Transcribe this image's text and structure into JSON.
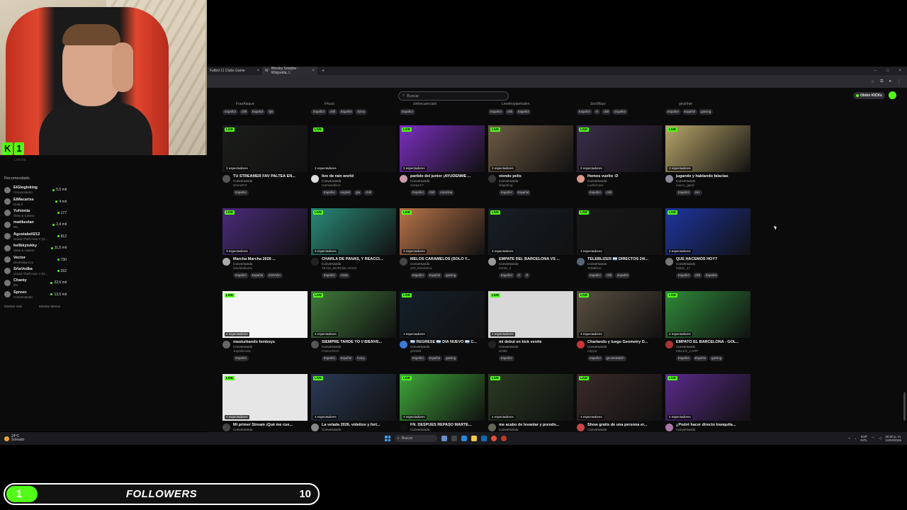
{
  "kick_badge": {
    "logo": "K",
    "count": "1"
  },
  "sidebar": {
    "topline": "Loncha",
    "title": "Recomendado",
    "items": [
      {
        "name": "ElGlogloking",
        "category": "Conversando",
        "count": "5,5 mil"
      },
      {
        "name": "ElMacariss",
        "category": "Dota 2",
        "count": "4 mil"
      },
      {
        "name": "Yuhinnta",
        "category": "Slots & Casino",
        "count": "177"
      },
      {
        "name": "mattkeelan",
        "category": "IRL",
        "count": "2,4 mil"
      },
      {
        "name": "Agustabell212",
        "category": "Grand Theft Auto V (G...",
        "count": "812"
      },
      {
        "name": "hellkkytokky",
        "category": "Slots & Casino",
        "count": "11,5 mil"
      },
      {
        "name": "Vector",
        "category": "Devil May Cry",
        "count": "730"
      },
      {
        "name": "SrtaVodka",
        "category": "Grand Theft Auto V (G...",
        "count": "262"
      },
      {
        "name": "Chanty",
        "category": "IRL",
        "count": "22,6 mil"
      },
      {
        "name": "Spreen",
        "category": "Conversando",
        "count": "13,5 mil"
      }
    ],
    "show_more": "Mostrar más",
    "show_less": "Mostrar Menos"
  },
  "browser": {
    "tabs": [
      {
        "title": "Futbol 11 Clubs Game"
      },
      {
        "title": "Wesley Sneijder - Wikipedia, L"
      }
    ],
    "search_placeholder": "Buscar",
    "get_kicks": "Obtén KICKs"
  },
  "top_row": [
    {
      "user": "FranAlaque",
      "tags": [
        "Español",
        "chill",
        "Español",
        "fps"
      ]
    },
    {
      "user": "F4uco",
      "tags": [
        "Español",
        "chill",
        "Español",
        "funny"
      ]
    },
    {
      "user": "sinfrecuenciatv",
      "tags": [
        "Español"
      ]
    },
    {
      "user": "Leontroplaelvalen",
      "tags": [
        "Español",
        "chill",
        "Español"
      ]
    },
    {
      "user": "SixxWayz",
      "tags": [
        "Español",
        "irl",
        "chill",
        "Español"
      ]
    },
    {
      "user": "ginshher",
      "tags": [
        "Español",
        "Español",
        "gaming"
      ]
    }
  ],
  "streams": [
    {
      "viewers": "3 espectadores",
      "title": "TU STREAMER FAV PALTEA EN...",
      "category": "Conversando",
      "user": "DracoPrrr",
      "tags": [
        "Español"
      ],
      "thumb": "#1b1d1a",
      "avatar": "#555"
    },
    {
      "viewers": "3 espectadores",
      "title": "live de rain world",
      "category": "Conversando",
      "user": "Gamaedirect",
      "tags": [
        "Español",
        "english",
        "gta",
        "chill"
      ],
      "thumb": "#0d0d0f",
      "avatar": "#ddd"
    },
    {
      "viewers": "3 espectadores",
      "title": "partido del junior ¡AYUDENME ...",
      "category": "Conversando",
      "user": "Gedye17",
      "tags": [
        "Español",
        "chill",
        "colombia"
      ],
      "thumb": "#7b2fbf",
      "avatar": "#c9a"
    },
    {
      "viewers": "3 espectadores",
      "title": "viendo pelis",
      "category": "Conversando",
      "user": "lafigoking",
      "tags": [
        "Español",
        "Español"
      ],
      "thumb": "#6e5a44",
      "avatar": "#333"
    },
    {
      "viewers": "3 espectadores",
      "title": "Hemos vuelto :D",
      "category": "Conversando",
      "user": "LudmiCaro",
      "tags": [
        "Español",
        "chill"
      ],
      "thumb": "#3a2e4a",
      "avatar": "#d98"
    },
    {
      "viewers": "3 espectadores",
      "title": "jugando y hablando falacias",
      "category": "Conversando",
      "user": "marce_gardi",
      "tags": [
        "Español",
        "18+"
      ],
      "thumb": "#b8a56a",
      "avatar": "#889"
    },
    {
      "viewers": "3 espectadores",
      "title": "Marcha Marcha 2026 ...",
      "category": "Conversando",
      "user": "latvdelabuelo",
      "tags": [
        "Español",
        "Español",
        "ESPAÑA"
      ],
      "thumb": "#4a2c7a",
      "avatar": "#aaa"
    },
    {
      "viewers": "3 espectadores",
      "title": "CHARLA DE PANAS, Y REACCI...",
      "category": "Conversando",
      "user": "TEAM_MURCIELAGOS",
      "tags": [
        "Español",
        "chats"
      ],
      "thumb": "#2a8a78",
      "avatar": "#222"
    },
    {
      "viewers": "3 espectadores",
      "title": "MELOS CARAMELOS (SOLO Y...",
      "category": "Conversando",
      "user": "s20_assassino",
      "tags": [
        "Español",
        "Español",
        "gaming"
      ],
      "thumb": "#b8744a",
      "avatar": "#444"
    },
    {
      "viewers": "3 espectadores",
      "title": "EMPATE DEL BARCELONA VS ...",
      "category": "Conversando",
      "user": "totoss_2",
      "tags": [
        "Español",
        "irl",
        "irl"
      ],
      "thumb": "#161e26",
      "avatar": "#999"
    },
    {
      "viewers": "3 espectadores",
      "title": "TELEBLIZER 🇦🇷 DIRECTOS 24/...",
      "category": "Conversando",
      "user": "TeleBlizer",
      "tags": [
        "Español",
        "chill",
        "Español"
      ],
      "thumb": "#181818",
      "avatar": "#567"
    },
    {
      "viewers": "3 espectadores",
      "title": "QUE HACEMOS HOY?",
      "category": "Conversando",
      "user": "Mdiaz_17",
      "tags": [
        "Español",
        "chill",
        "Español"
      ],
      "thumb": "#1e35a0",
      "avatar": "#777"
    },
    {
      "viewers": "4 espectadores",
      "title": "masturbando femboys",
      "category": "Conversando",
      "user": "Jugodeuvas",
      "tags": [
        "Español"
      ],
      "thumb": "#f5f5f5",
      "avatar": "#666"
    },
    {
      "viewers": "4 espectadores",
      "title": "SIEMPRE TARDE YO // BIENVE...",
      "category": "Conversando",
      "user": "FrancoTe12",
      "tags": [
        "Español",
        "Español",
        "funny"
      ],
      "thumb": "#3f7a3a",
      "avatar": "#555"
    },
    {
      "viewers": "4 espectadores",
      "title": "🇦🇷 REGRESE 🇦🇷 DIA NUEVO 🇦🇷 C...",
      "category": "Conversando",
      "user": "gex569",
      "tags": [
        "Español",
        "Español",
        "gaming"
      ],
      "thumb": "#14202a",
      "avatar": "#3a7bd5"
    },
    {
      "viewers": "4 espectadores",
      "title": "mi debut en kick venite",
      "category": "Conversando",
      "user": "W3ktt",
      "tags": [
        "Español"
      ],
      "thumb": "#d8d8d8",
      "avatar": "#222"
    },
    {
      "viewers": "4 espectadores",
      "title": "Charlando y luego Geometry D...",
      "category": "Conversando",
      "user": "relpyxt",
      "tags": [
        "Español",
        "geometrdash"
      ],
      "thumb": "#5a5040",
      "avatar": "#c33"
    },
    {
      "viewers": "4 espectadores",
      "title": "EMPATO EL BARCELONA - GOL...",
      "category": "Conversando",
      "user": "MELKO_CARP",
      "tags": [
        "Español",
        "Español",
        "gaming"
      ],
      "thumb": "#2f8a3a",
      "avatar": "#a33"
    },
    {
      "viewers": "4 espectadores",
      "title": "Mi primer Stream ¡Qué me cue...",
      "category": "Conversando",
      "user": "",
      "tags": [],
      "thumb": "#e6e6e6",
      "avatar": "#444"
    },
    {
      "viewers": "4 espectadores",
      "title": "La velada 2026, videitos y fort...",
      "category": "Conversando",
      "user": "",
      "tags": [],
      "thumb": "#2a3a55",
      "avatar": "#888"
    },
    {
      "viewers": "4 espectadores",
      "title": "FN. DESPUES REPASO MARTE...",
      "category": "Conversando",
      "user": "",
      "tags": [],
      "thumb": "#3fa53a",
      "avatar": "#111"
    },
    {
      "viewers": "4 espectadores",
      "title": "me acabo de levantar y prendo...",
      "category": "Conversando",
      "user": "",
      "tags": [],
      "thumb": "#2a3a22",
      "avatar": "#665"
    },
    {
      "viewers": "4 espectadores",
      "title": "Show gratis de una persona er...",
      "category": "Conversando",
      "user": "",
      "tags": [],
      "thumb": "#3a2a2a",
      "avatar": "#c44"
    },
    {
      "viewers": "4 espectadores",
      "title": "¿Podré hacer directo tranquila...",
      "category": "Conversando",
      "user": "",
      "tags": [],
      "thumb": "#5a2a8a",
      "avatar": "#a7a"
    }
  ],
  "live_label": "LIVE",
  "taskbar": {
    "weather_temp": "24°C",
    "weather_desc": "Soleado",
    "search": "Buscar",
    "lang": "ESP",
    "lang2": "INTL",
    "time": "00:00 p. m.",
    "date": "10/03/2026"
  },
  "followers": {
    "current": "1",
    "label": "FOLLOWERS",
    "goal": "10",
    "progress": 0.1
  }
}
